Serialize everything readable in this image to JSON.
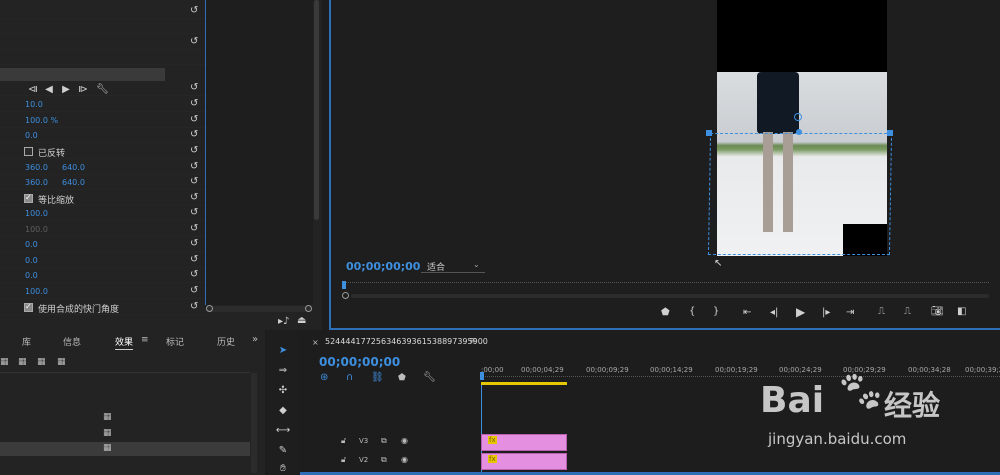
{
  "effect_controls": {
    "playback_icons": [
      "step-back-icon",
      "play-reverse-icon",
      "play-icon",
      "step-forward-icon",
      "wrench-icon"
    ],
    "rows": [
      {
        "v1": "10.0",
        "v2": "",
        "style": "blue"
      },
      {
        "v1": "100.0 %",
        "v2": "",
        "style": "blue"
      },
      {
        "v1": "0.0",
        "v2": "",
        "style": "blue"
      },
      {
        "check": false,
        "label": "已反转"
      },
      {
        "v1": "360.0",
        "v2": "640.0",
        "style": "blue"
      },
      {
        "v1": "360.0",
        "v2": "640.0",
        "style": "blue"
      },
      {
        "check": true,
        "label": "等比缩放"
      },
      {
        "v1": "100.0",
        "v2": "",
        "style": "blue"
      },
      {
        "v1": "100.0",
        "v2": "",
        "style": "dim"
      },
      {
        "v1": "0.0",
        "v2": "",
        "style": "blue"
      },
      {
        "v1": "0.0",
        "v2": "",
        "style": "blue"
      },
      {
        "v1": "0.0",
        "v2": "",
        "style": "blue"
      },
      {
        "v1": "100.0",
        "v2": "",
        "style": "blue"
      },
      {
        "check": true,
        "label": "使用合成的快门角度"
      }
    ]
  },
  "program_monitor": {
    "timecode": "00;00;00;00",
    "fit_label": "适合"
  },
  "panel_tabs": {
    "library": "库",
    "info": "信息",
    "effects": "效果",
    "markers": "标记",
    "history": "历史"
  },
  "sequence": {
    "name": "5244441772563463936153889739590​0",
    "timecode": "00;00;00;00",
    "ruler": [
      ":00;00",
      "00;00;04;29",
      "00;00;09;29",
      "00;00;14;29",
      "00;00;19;29",
      "00;00;24;29",
      "00;00;29;29",
      "00;00;34;28",
      "00;00;39;2"
    ],
    "tracks": [
      {
        "name": "V3",
        "clip": "fx"
      },
      {
        "name": "V2",
        "clip": "fx"
      }
    ]
  },
  "watermark": {
    "brand": "Bai",
    "brand2": "经验",
    "url": "jingyan.baidu.com"
  },
  "colors": {
    "accent_blue": "#3d8fe0",
    "clip_pink": "#e58fe0",
    "playhead_yellow": "#e6c800"
  }
}
